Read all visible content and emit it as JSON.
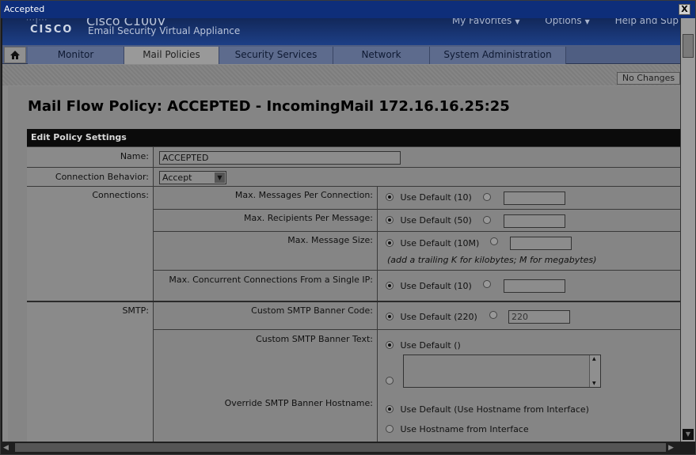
{
  "window": {
    "title": "Accepted",
    "close_label": "X"
  },
  "header": {
    "logo_dots": "···|···",
    "logo": "CISCO",
    "product_name": "Cisco C100V",
    "product_sub": "Email Security Virtual Appliance",
    "util_nav": [
      "My Favorites",
      "Options",
      "Help and Sup"
    ]
  },
  "tabs": [
    "Monitor",
    "Mail Policies",
    "Security Services",
    "Network",
    "System Administration"
  ],
  "active_tab": "Mail Policies",
  "no_changes_label": "No Changes",
  "page_title": "Mail Flow Policy: ACCEPTED - IncomingMail 172.16.16.25:25",
  "section_title": "Edit Policy Settings",
  "fields": {
    "name_label": "Name:",
    "name_value": "ACCEPTED",
    "conn_behavior_label": "Connection Behavior:",
    "conn_behavior_value": "Accept",
    "connections_label": "Connections:",
    "max_msgs_label": "Max. Messages Per Connection:",
    "max_msgs_default": "Use Default (10)",
    "max_rcpts_label": "Max. Recipients Per Message:",
    "max_rcpts_default": "Use Default (50)",
    "max_size_label": "Max. Message Size:",
    "max_size_default": "Use Default (10M)",
    "max_size_hint": "(add a trailing K for kilobytes; M for megabytes)",
    "max_concurrent_label": "Max. Concurrent Connections From a Single IP:",
    "max_concurrent_default": "Use Default (10)",
    "smtp_label": "SMTP:",
    "banner_code_label": "Custom SMTP Banner Code:",
    "banner_code_default": "Use Default (220)",
    "banner_code_value": "220",
    "banner_text_label": "Custom SMTP Banner Text:",
    "banner_text_default": "Use Default ()",
    "override_host_label": "Override SMTP Banner Hostname:",
    "override_host_default": "Use Default (Use Hostname from Interface)",
    "override_host_iface": "Use Hostname from Interface"
  },
  "colors": {
    "titlebar": "#0e2e7a",
    "section_head": "#0b0b0b"
  }
}
